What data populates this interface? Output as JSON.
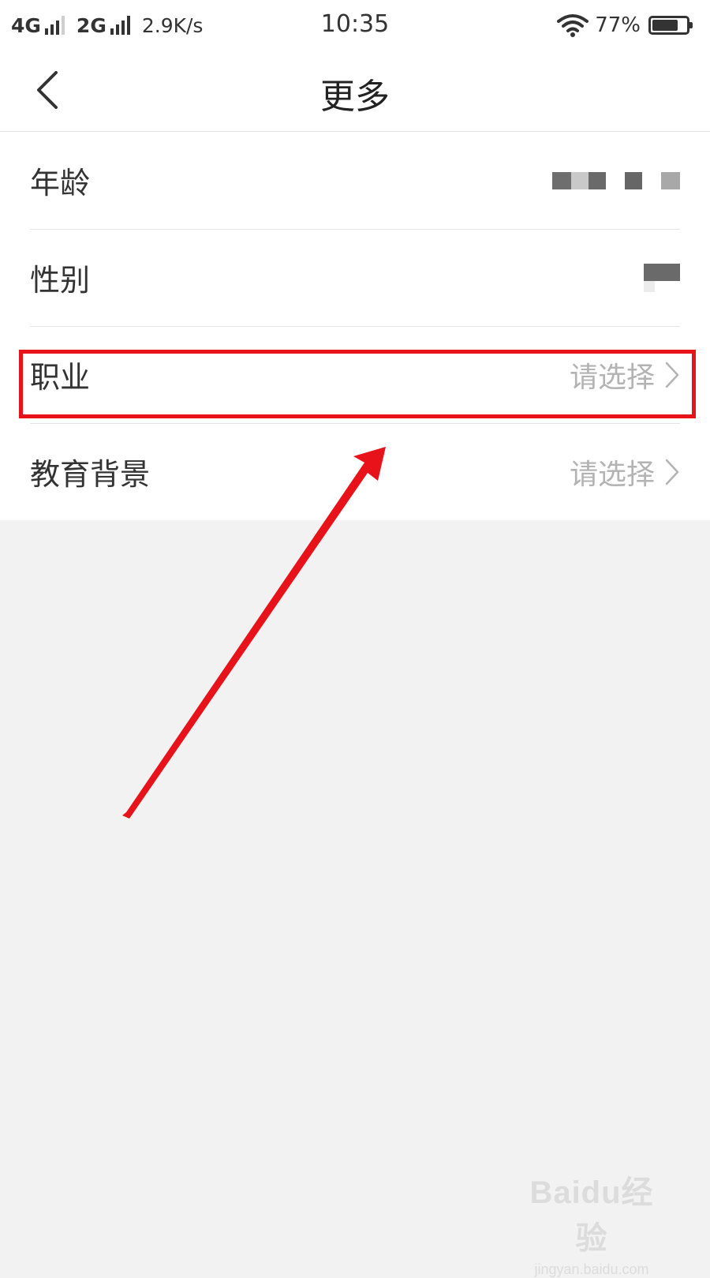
{
  "status_bar": {
    "network1": "4G",
    "network2": "2G",
    "speed": "2.9K/s",
    "time": "10:35",
    "battery_percent": "77%",
    "battery_level": 0.77,
    "icons": [
      "signal-icon",
      "wifi-icon",
      "battery-icon"
    ]
  },
  "nav": {
    "back_icon": "chevron-left-icon",
    "title": "更多"
  },
  "rows": [
    {
      "label": "年龄",
      "value": "",
      "value_obscured": true
    },
    {
      "label": "性别",
      "value": "",
      "value_obscured": true
    },
    {
      "label": "职业",
      "value": "请选择",
      "highlighted": true
    },
    {
      "label": "教育背景",
      "value": "请选择"
    }
  ],
  "annotation": {
    "highlight_color": "#e8121b",
    "arrow_color": "#e8121b"
  },
  "watermark": {
    "logo": "Baidu经验",
    "url": "jingyan.baidu.com"
  },
  "colors": {
    "background": "#f2f2f2",
    "surface": "#ffffff",
    "text_primary": "#333333",
    "text_placeholder": "#b3b3b3",
    "divider": "#e4e4e4"
  }
}
